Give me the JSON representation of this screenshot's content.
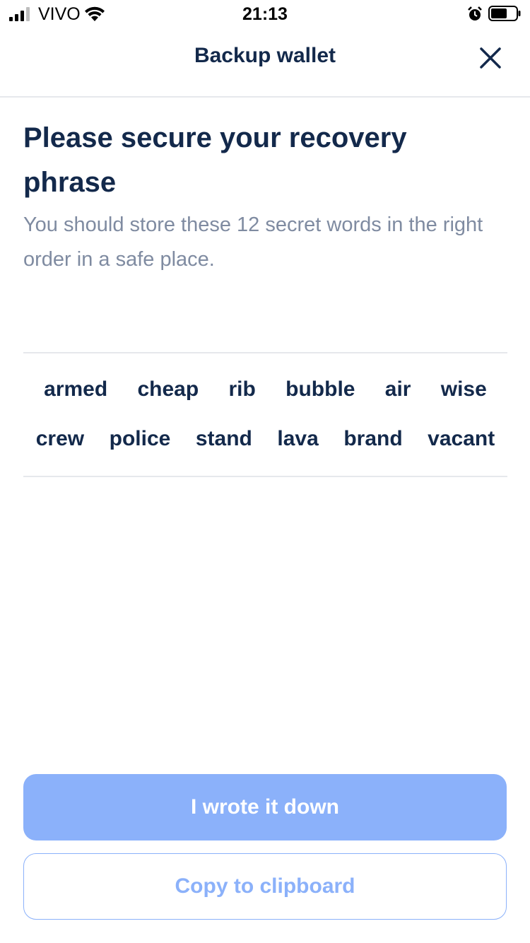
{
  "status_bar": {
    "carrier": "VIVO",
    "time": "21:13"
  },
  "nav": {
    "title": "Backup wallet",
    "close_icon": "close-icon"
  },
  "content": {
    "heading": "Please secure your recovery phrase",
    "subtitle": "You should store these 12 secret words in the right order in a safe place."
  },
  "phrase": {
    "row1": [
      "armed",
      "cheap",
      "rib",
      "bubble",
      "air",
      "wise"
    ],
    "row2": [
      "crew",
      "police",
      "stand",
      "lava",
      "brand",
      "vacant"
    ]
  },
  "actions": {
    "primary_label": "I wrote it down",
    "secondary_label": "Copy to clipboard"
  },
  "colors": {
    "text_dark": "#13294b",
    "text_muted": "#7f8ba1",
    "accent": "#8bb1fa",
    "divider": "#e6e8ec"
  }
}
